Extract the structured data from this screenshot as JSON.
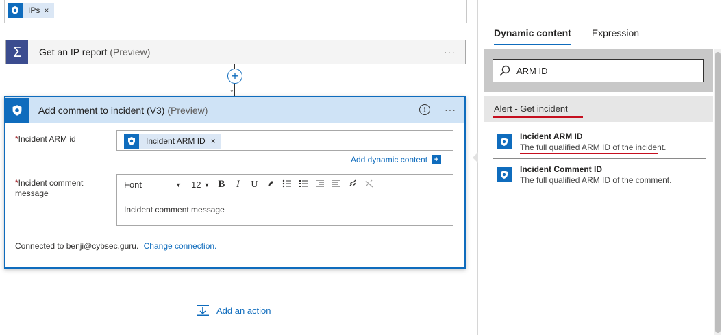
{
  "previous_step": {
    "token_label": "IPs",
    "token_remove": "×"
  },
  "ip_report_action": {
    "title": "Get an IP report",
    "preview": "(Preview)",
    "menu": "···"
  },
  "connector": {
    "add_symbol": "+",
    "arrow": "↓"
  },
  "main_action": {
    "title": "Add comment to incident (V3)",
    "preview": "(Preview)",
    "info": "i",
    "menu": "···",
    "arm_field": {
      "required_mark": "*",
      "label": "Incident ARM id",
      "token_label": "Incident ARM ID",
      "token_remove": "×"
    },
    "add_dynamic_label": "Add dynamic content",
    "add_dynamic_plus": "+",
    "comment_field": {
      "required_mark": "*",
      "label": "Incident comment message",
      "placeholder": "Incident comment message"
    },
    "toolbar": {
      "font": "Font",
      "size": "12",
      "caret": "▼",
      "bold": "B",
      "italic": "I",
      "underline": "U"
    },
    "connection_text": "Connected to benji@cybsec.guru.",
    "change_connection": "Change connection."
  },
  "add_action_label": "Add an action",
  "dynamic_panel": {
    "tabs": [
      {
        "label": "Dynamic content",
        "active": true
      },
      {
        "label": "Expression",
        "active": false
      }
    ],
    "search_value": "ARM ID",
    "section_title": "Alert - Get incident",
    "items": [
      {
        "name": "Incident ARM ID",
        "description": "The full qualified ARM ID of the incident."
      },
      {
        "name": "Incident Comment ID",
        "description": "The full qualified ARM ID of the comment."
      }
    ]
  },
  "colors": {
    "accent": "#0f6cbd",
    "header_bg": "#cfe3f6",
    "highlight_red": "#c50f1f",
    "sigma_bg": "#3b4c8f"
  },
  "icons": [
    "sentinel-icon",
    "sigma-icon",
    "plus-circle-icon",
    "info-icon",
    "search-icon",
    "add-action-icon",
    "pen-icon",
    "bullet-list-icon",
    "numbered-list-icon",
    "indent-icon",
    "outdent-icon",
    "link-icon",
    "unlink-icon"
  ]
}
